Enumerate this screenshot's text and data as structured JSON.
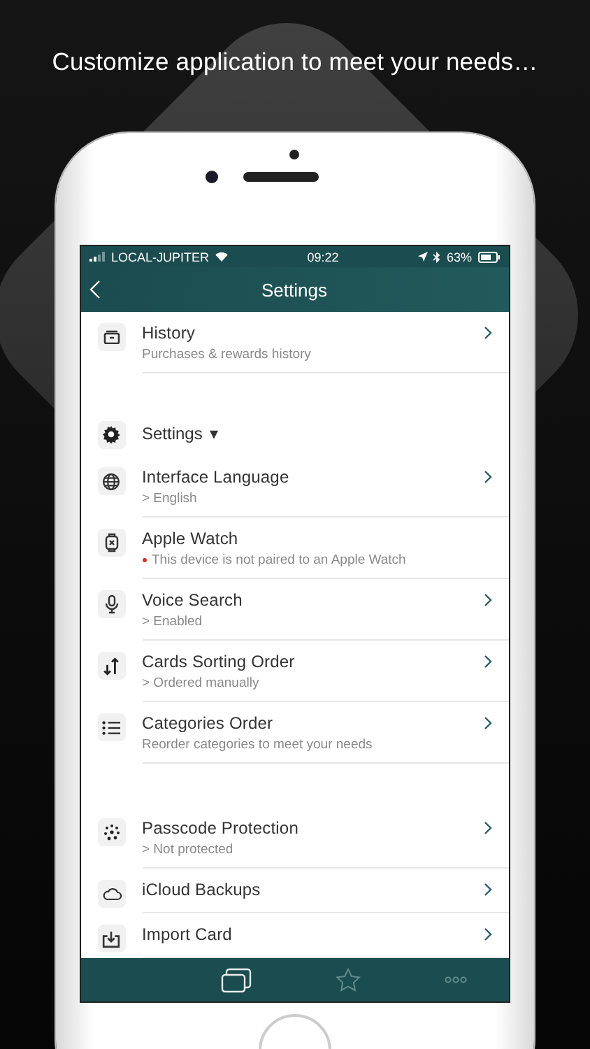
{
  "headline": "Customize application to meet your needs…",
  "status_bar": {
    "carrier": "LOCAL-JUPITER",
    "time": "09:22",
    "battery": "63%"
  },
  "nav": {
    "title": "Settings"
  },
  "items": [
    {
      "kind": "row",
      "title": "History",
      "subtitle": "Purchases & rewards history",
      "chevron": true,
      "alert": false
    },
    {
      "kind": "gap"
    },
    {
      "kind": "section",
      "title": "Settings",
      "caret": "▾"
    },
    {
      "kind": "row",
      "title": "Interface Language",
      "subtitle": "> English",
      "chevron": true,
      "alert": false
    },
    {
      "kind": "row",
      "title": "Apple Watch",
      "subtitle": "This device is not paired to an Apple Watch",
      "chevron": false,
      "alert": true
    },
    {
      "kind": "row",
      "title": "Voice Search",
      "subtitle": "> Enabled",
      "chevron": true,
      "alert": false
    },
    {
      "kind": "row",
      "title": "Cards Sorting Order",
      "subtitle": "> Ordered manually",
      "chevron": true,
      "alert": false
    },
    {
      "kind": "row",
      "title": "Categories Order",
      "subtitle": "Reorder categories to meet your needs",
      "chevron": true,
      "alert": false
    },
    {
      "kind": "gap"
    },
    {
      "kind": "row",
      "title": "Passcode Protection",
      "subtitle": "> Not protected",
      "chevron": true,
      "alert": false
    },
    {
      "kind": "row",
      "title": "iCloud Backups",
      "chevron": true,
      "alert": false
    },
    {
      "kind": "row",
      "title": "Import Card",
      "chevron": true,
      "alert": false
    }
  ],
  "tabs": [
    {
      "selected": true
    },
    {
      "selected": false
    },
    {
      "selected": false
    }
  ]
}
